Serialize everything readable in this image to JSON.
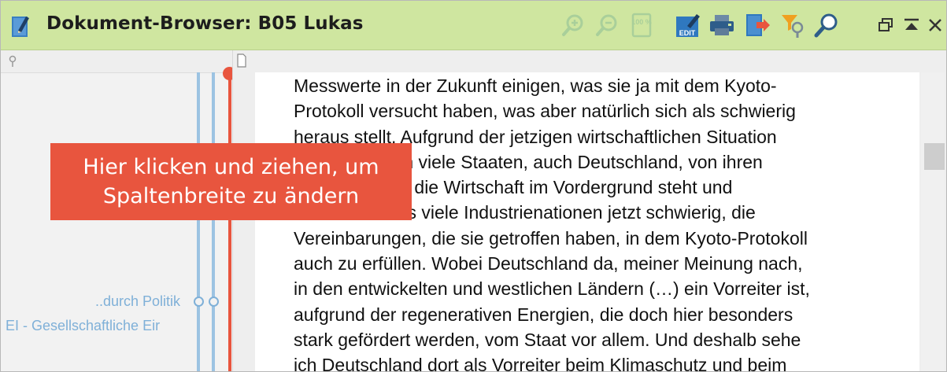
{
  "window": {
    "title": "Dokument-Browser: B05 Lukas"
  },
  "toolbar": {
    "buttons": [
      {
        "name": "zoom-in",
        "icon": "zoom-in-icon"
      },
      {
        "name": "zoom-out",
        "icon": "zoom-out-icon"
      },
      {
        "name": "zoom-100",
        "icon": "zoom-100-icon",
        "label": "100 %"
      },
      {
        "name": "edit",
        "icon": "edit-icon",
        "label": "EDIT"
      },
      {
        "name": "print",
        "icon": "print-icon"
      },
      {
        "name": "export",
        "icon": "export-icon"
      },
      {
        "name": "filter",
        "icon": "filter-icon"
      },
      {
        "name": "search",
        "icon": "search-icon"
      }
    ],
    "window_controls": [
      "restore-icon",
      "collapse-icon",
      "close-icon"
    ]
  },
  "code_panel": {
    "codes": [
      {
        "label": "..durch Politik"
      },
      {
        "label": "EI - Gesellschaftliche Eir"
      }
    ]
  },
  "document": {
    "lines": [
      "Messwerte in der Zukunft einigen, was sie ja mit dem Kyoto-",
      "Protokoll versucht haben, was aber natürlich sich als schwierig",
      "heraus stellt. Aufgrund der jetzigen wirtschaftlichen Situation",
      "treten natürlich viele Staaten, auch Deutschland, von ihren",
      "Zielen ab, weil die Wirtschaft im Vordergrund steht und",
      "somit haben es viele Industrienationen jetzt schwierig, die",
      "Vereinbarungen, die sie getroffen haben, in dem Kyoto-Protokoll",
      "auch zu erfüllen. Wobei Deutschland da, meiner Meinung nach,",
      "in den entwickelten und westlichen Ländern (…) ein Vorreiter ist,",
      "aufgrund der regenerativen Energien, die doch hier besonders",
      "stark gefördert werden, vom Staat vor allem. Und deshalb sehe",
      "ich Deutschland dort als Vorreiter beim Klimaschutz und beim"
    ]
  },
  "tooltip": {
    "line1": "Hier klicken und ziehen, um",
    "line2": "Spaltenbreite zu ändern"
  },
  "colors": {
    "titlebar_bg": "#cfe6a0",
    "accent_red": "#e8553e",
    "code_blue": "#7fb0d8"
  }
}
